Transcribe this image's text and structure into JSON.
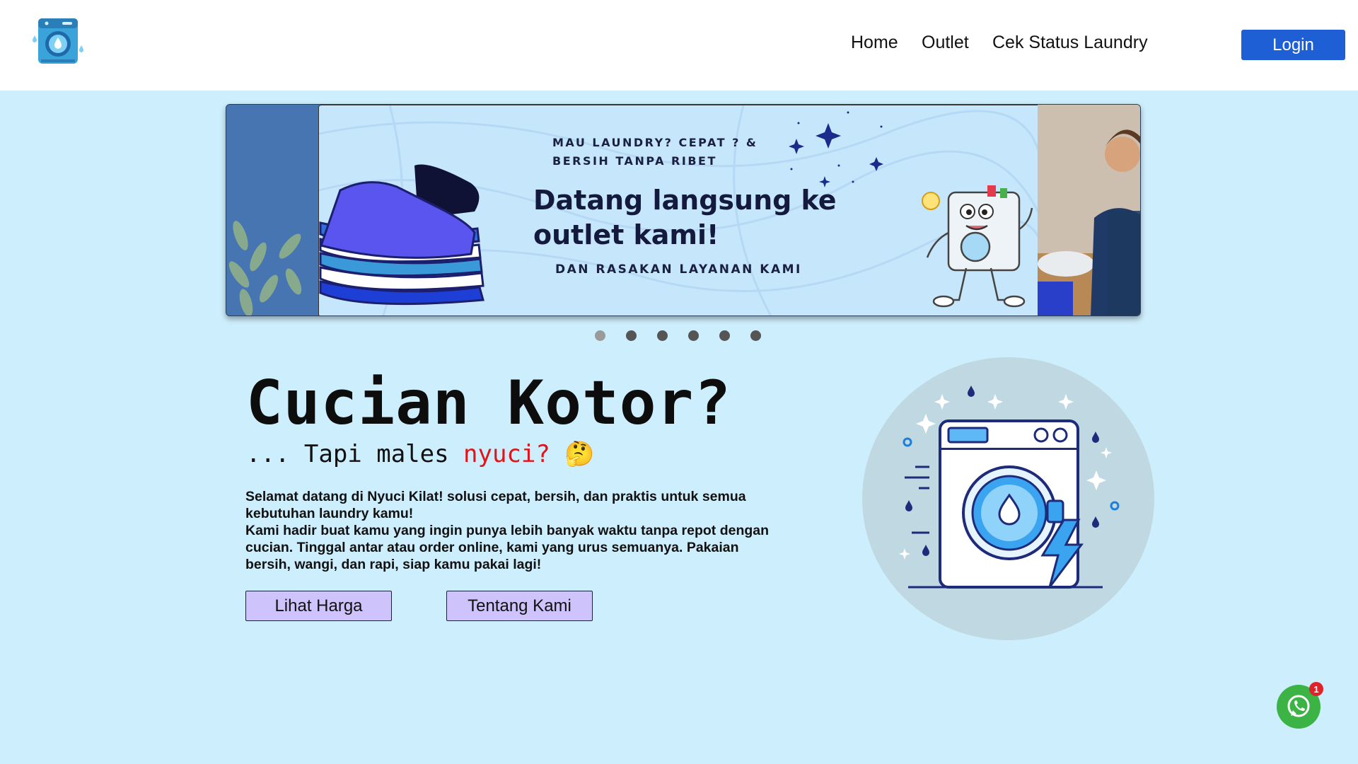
{
  "header": {
    "logo_icon": "washing-machine-logo-icon",
    "nav": [
      {
        "label": "Home"
      },
      {
        "label": "Outlet"
      },
      {
        "label": "Cek Status Laundry"
      }
    ],
    "login_label": "Login",
    "login_color": "#1f5fd6"
  },
  "carousel": {
    "active_slide": {
      "kicker_line1": "MAU LAUNDRY? CEPAT ? &",
      "kicker_line2": "BERSIH TANPA RIBET",
      "title_line1": "Datang langsung ke",
      "title_line2": "outlet kami!",
      "subtitle": "DAN RASAKAN LAYANAN KAMI"
    },
    "dot_count": 6,
    "active_dot": 1
  },
  "hero": {
    "title": "Cucian Kotor?",
    "sub_prefix": "... Tapi males ",
    "sub_accent": "nyuci?",
    "sub_emoji": "🤔",
    "accent_color": "#e0141a",
    "description": [
      "Selamat datang di Nyuci Kilat! solusi cepat, bersih, dan praktis untuk semua kebutuhan laundry kamu!",
      "Kami hadir buat kamu yang ingin punya lebih banyak waktu tanpa repot dengan cucian. Tinggal antar atau order online, kami yang urus semuanya. Pakaian bersih, wangi, dan rapi, siap kamu pakai lagi!"
    ],
    "buttons": {
      "price": "Lihat Harga",
      "about": "Tentang Kami"
    },
    "illustration_icon": "washing-machine-lightning-icon"
  },
  "whatsapp": {
    "icon": "whatsapp-icon",
    "badge": "1"
  }
}
